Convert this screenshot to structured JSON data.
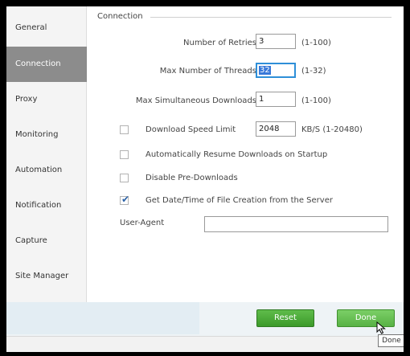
{
  "sidebar": {
    "items": [
      {
        "label": "General"
      },
      {
        "label": "Connection"
      },
      {
        "label": "Proxy"
      },
      {
        "label": "Monitoring"
      },
      {
        "label": "Automation"
      },
      {
        "label": "Notification"
      },
      {
        "label": "Capture"
      },
      {
        "label": "Site Manager"
      }
    ],
    "active": "Connection"
  },
  "section": {
    "title": "Connection"
  },
  "fields": {
    "retries": {
      "label": "Number of Retries",
      "value": "3",
      "range": "(1-100)"
    },
    "threads": {
      "label": "Max Number of Threads",
      "value": "32",
      "range": "(1-32)"
    },
    "downloads": {
      "label": "Max Simultaneous Downloads",
      "value": "1",
      "range": "(1-100)"
    },
    "speed": {
      "label": "Download Speed Limit",
      "value": "2048",
      "range": "KB/S (1-20480)"
    }
  },
  "options": {
    "speed_limit": {
      "checked": false
    },
    "auto_resume": {
      "label": "Automatically Resume Downloads on Startup",
      "checked": false
    },
    "disable_pre": {
      "label": "Disable Pre-Downloads",
      "checked": false
    },
    "get_date": {
      "label": "Get Date/Time of File Creation from the Server",
      "checked": true
    }
  },
  "user_agent": {
    "label": "User-Agent",
    "value": ""
  },
  "buttons": {
    "reset": "Reset",
    "done": "Done"
  },
  "tooltip": "Done",
  "colors": {
    "active_sidebar": "#8c8c8c",
    "button_green": "#3c9a2a",
    "focus_blue": "#2e8fd8"
  }
}
